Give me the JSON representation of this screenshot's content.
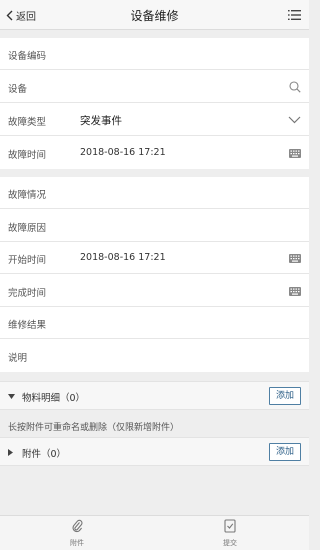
{
  "header": {
    "back_label": "返回",
    "title": "设备维修"
  },
  "form1": {
    "device_code_label": "设备编码",
    "device_label": "设备",
    "fault_type_label": "故障类型",
    "fault_type_value": "突发事件",
    "fault_time_label": "故障时间",
    "fault_time_value": "2018-08-16 17:21"
  },
  "form2": {
    "fault_situation_label": "故障情况",
    "fault_cause_label": "故障原因",
    "start_time_label": "开始时间",
    "start_time_value": "2018-08-16 17:21",
    "finish_time_label": "完成时间",
    "repair_result_label": "维修结果",
    "description_label": "说明"
  },
  "materials": {
    "label": "物料明细（0）",
    "add_label": "添加"
  },
  "attachments_note": "长按附件可重命名或删除（仅限新增附件）",
  "attachments": {
    "label": "附件（0）",
    "add_label": "添加"
  },
  "tabbar": {
    "attach_label": "附件",
    "submit_label": "提交"
  },
  "colors": {
    "accent": "#4f7fa3",
    "background": "#eeeeee"
  }
}
